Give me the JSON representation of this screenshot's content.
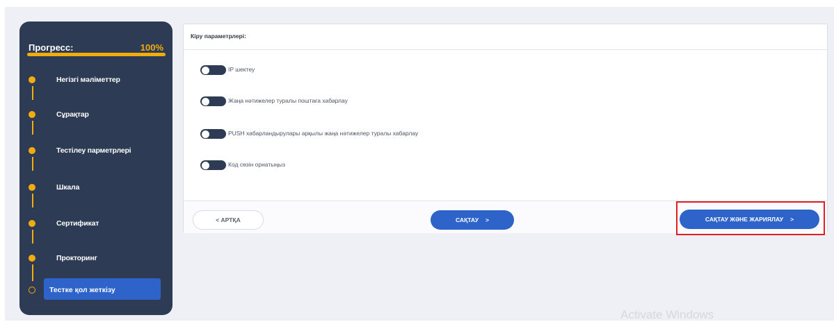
{
  "sidebar": {
    "progress_title": "Прогресс:",
    "progress_value": "100%",
    "progress_fraction": 1.0,
    "steps": [
      {
        "label": "Негізгі мәліметтер"
      },
      {
        "label": "Сұрақтар"
      },
      {
        "label": "Тестілеу парметрлері"
      },
      {
        "label": "Шкала"
      },
      {
        "label": "Сертификат"
      },
      {
        "label": "Прокторинг"
      },
      {
        "label": "Тестке қол жеткізу"
      }
    ]
  },
  "card": {
    "title": "Кіру параметрлері:",
    "toggles": [
      {
        "label": "IP шектеу",
        "on": false
      },
      {
        "label": "Жаңа нәтижелер туралы поштаға хабарлау",
        "on": false
      },
      {
        "label": "PUSH хабарландырулары арқылы жаңа нәтижелер туралы хабарлау",
        "on": false
      },
      {
        "label": "Код сөзін орнатыңыз",
        "on": false
      }
    ]
  },
  "footer": {
    "back_label": "< АРТҚА",
    "save_label": "САҚТАУ",
    "save_chevron": ">",
    "publish_label": "САҚТАУ ЖӘНЕ ЖАРИЯЛАУ",
    "publish_chevron": ">"
  },
  "watermark": "Activate Windows",
  "colors": {
    "sidebar_bg": "#2d3b55",
    "accent": "#f2ad0d",
    "primary_button": "#2e63c9",
    "highlight_outline": "#e02020"
  }
}
